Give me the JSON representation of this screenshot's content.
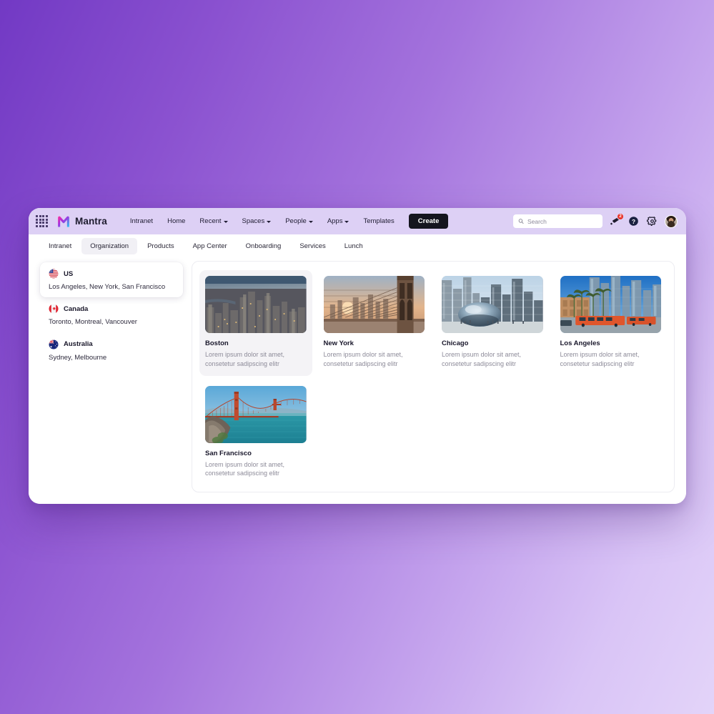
{
  "header": {
    "app_grid_icon": "app-grid-icon",
    "brand_name": "Mantra",
    "nav": [
      {
        "label": "Intranet",
        "has_caret": false
      },
      {
        "label": "Home",
        "has_caret": false
      },
      {
        "label": "Recent",
        "has_caret": true
      },
      {
        "label": "Spaces",
        "has_caret": true
      },
      {
        "label": "People",
        "has_caret": true
      },
      {
        "label": "Apps",
        "has_caret": true
      },
      {
        "label": "Templates",
        "has_caret": false
      }
    ],
    "create_label": "Create",
    "search": {
      "placeholder": "Search",
      "value": "",
      "icon": "search-icon"
    },
    "notifications": {
      "icon": "megaphone-icon",
      "badge_count": "2",
      "badge_color": "#e8342a"
    },
    "help_icon": "help-circle-icon",
    "settings_icon": "gear-icon",
    "avatar": "user-avatar"
  },
  "subnav": {
    "items": [
      {
        "label": "Intranet",
        "active": false
      },
      {
        "label": "Organization",
        "active": true
      },
      {
        "label": "Products",
        "active": false
      },
      {
        "label": "App Center",
        "active": false
      },
      {
        "label": "Onboarding",
        "active": false
      },
      {
        "label": "Services",
        "active": false
      },
      {
        "label": "Lunch",
        "active": false
      }
    ]
  },
  "sidebar": {
    "items": [
      {
        "country": "US",
        "flag": "flag-us",
        "cities": "Los Angeles, New York, San Francisco",
        "selected": true
      },
      {
        "country": "Canada",
        "flag": "flag-canada",
        "cities": "Toronto, Montreal, Vancouver",
        "selected": false
      },
      {
        "country": "Australia",
        "flag": "flag-australia",
        "cities": "Sydney, Melbourne",
        "selected": false
      }
    ]
  },
  "content": {
    "cards": [
      {
        "title": "Boston",
        "description": "Lorem ipsum dolor sit amet,\nconsetetur sadipscing elitr",
        "image": "boston-aerial-skyline",
        "selected": true
      },
      {
        "title": "New York",
        "description": "Lorem ipsum dolor sit amet,\nconsetetur sadipscing elitr",
        "image": "new-york-brooklyn-bridge-sunset",
        "selected": false
      },
      {
        "title": "Chicago",
        "description": "Lorem ipsum dolor sit amet,\nconsetetur sadipscing elitr",
        "image": "chicago-cloud-gate-bean",
        "selected": false
      },
      {
        "title": "Los Angeles",
        "description": "Lorem ipsum dolor sit amet,\nconsetetur sadipscing elitr",
        "image": "los-angeles-downtown-palms",
        "selected": false
      },
      {
        "title": "San Francisco",
        "description": "Lorem ipsum dolor sit amet,\nconsetetur sadipscing elitr",
        "image": "san-francisco-golden-gate-bridge",
        "selected": false
      }
    ]
  },
  "theme": {
    "background_gradient_from": "#7239c4",
    "background_gradient_to": "#e3d4f9",
    "topbar_bg": "#ddd0f5",
    "create_button_bg": "#15151f",
    "active_tab_bg": "#f1f0f5"
  }
}
